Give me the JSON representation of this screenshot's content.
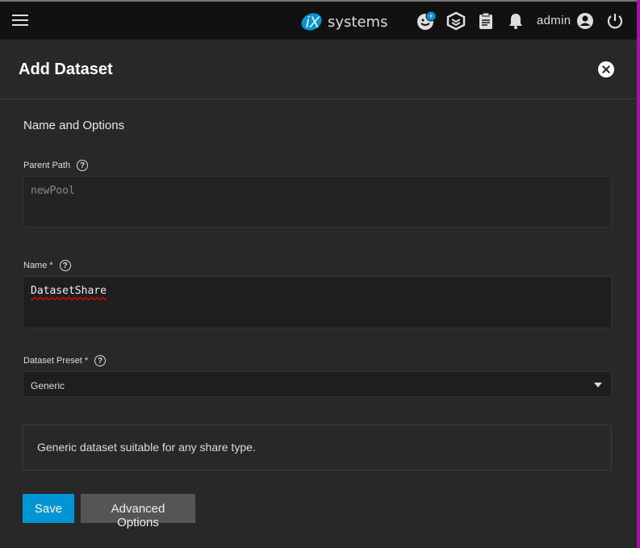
{
  "topbar": {
    "logo_text": "iXsystems",
    "user": "admin",
    "icons": [
      "menu-icon",
      "feedback-icon",
      "truecommand-icon",
      "clipboard-icon",
      "bell-icon",
      "account-icon",
      "power-icon"
    ]
  },
  "dialog": {
    "title": "Add Dataset",
    "section": "Name and Options",
    "parent_path": {
      "label": "Parent Path",
      "value": "newPool"
    },
    "name": {
      "label": "Name *",
      "value": "DatasetShare"
    },
    "preset": {
      "label": "Dataset Preset *",
      "value": "Generic"
    },
    "description": "Generic dataset suitable for any share type.",
    "save": "Save",
    "advanced": "Advanced Options"
  },
  "colors": {
    "accent": "#0095d5",
    "topbar": "#111111",
    "background": "#282828",
    "edge": "#c000c0"
  }
}
